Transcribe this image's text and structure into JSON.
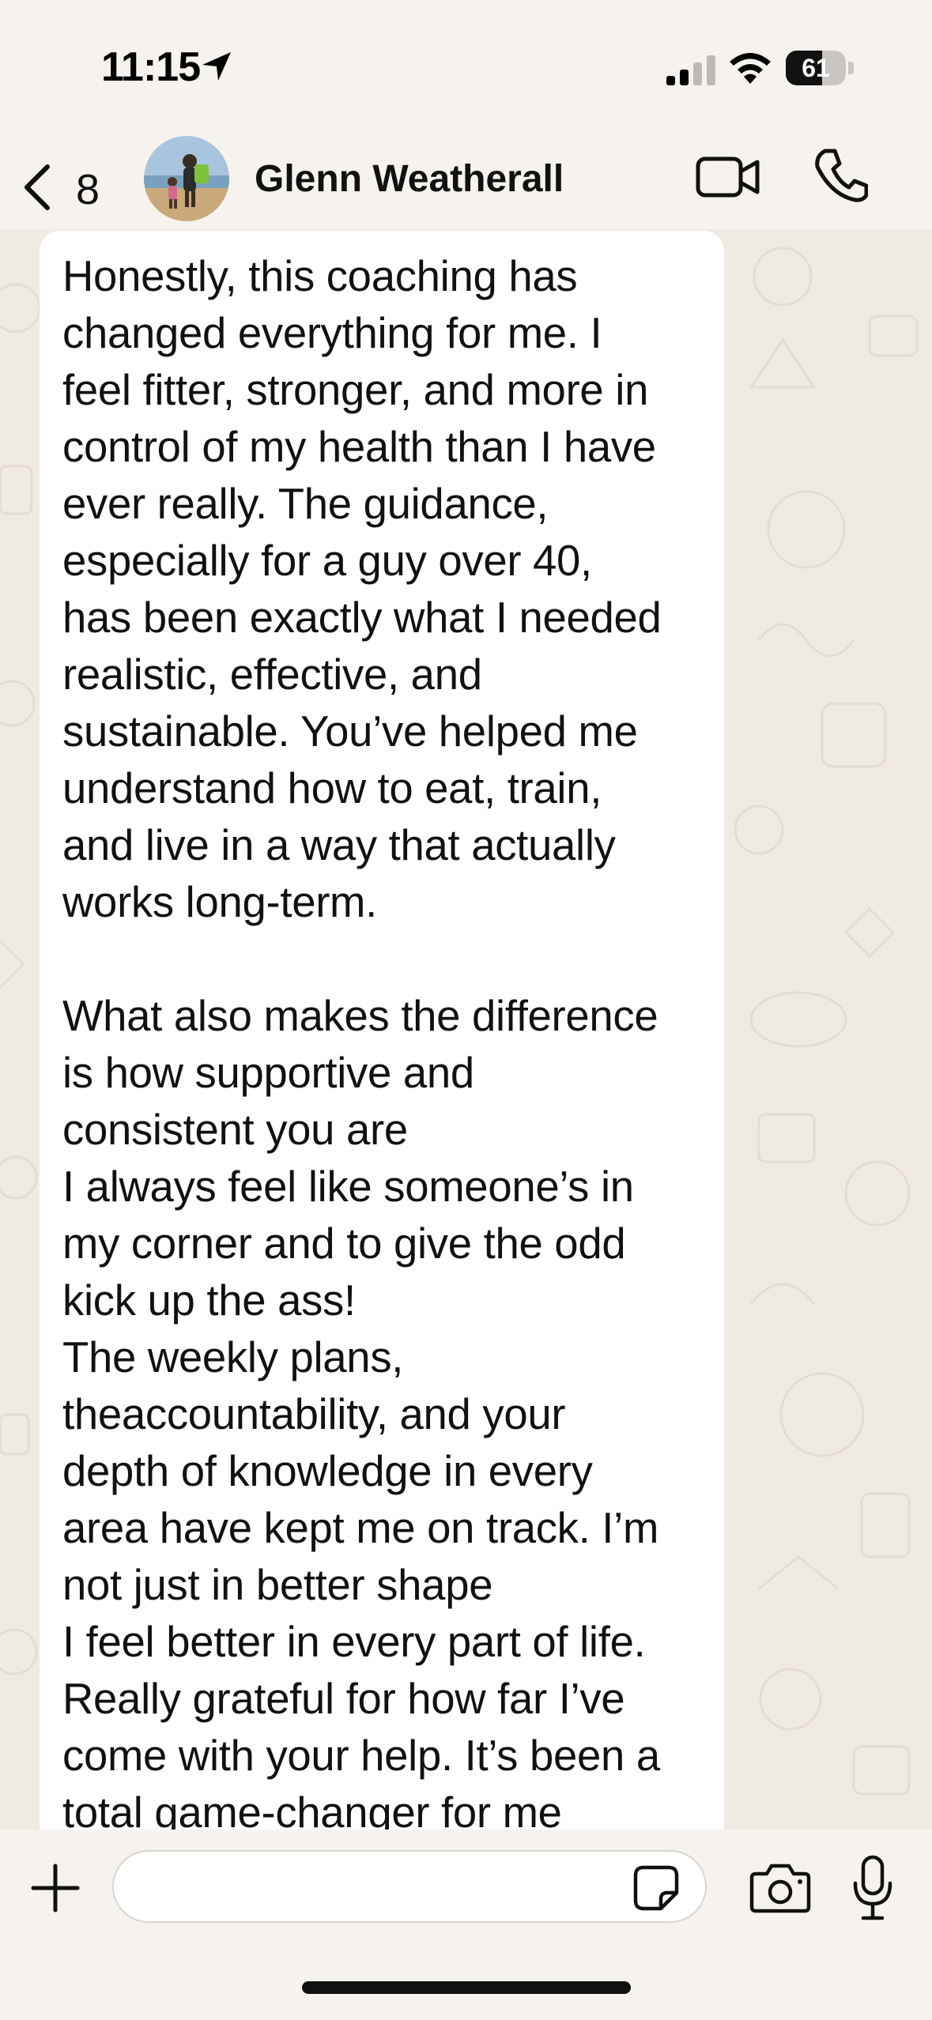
{
  "status_bar": {
    "time": "11:15",
    "battery_level": "61",
    "battery_fraction": 0.61,
    "signal_bars_active": 2,
    "signal_bars_total": 4,
    "icons": [
      "location-arrow-icon",
      "cellular-signal-icon",
      "wifi-icon",
      "battery-icon"
    ]
  },
  "header": {
    "unread_count": "8",
    "contact_name": "Glenn Weatherall",
    "icons": [
      "back-chevron-icon",
      "avatar",
      "video-call-icon",
      "phone-icon"
    ]
  },
  "message": {
    "text": "Honestly, this coaching has\nchanged everything for me. I\nfeel fitter, stronger, and more in\ncontrol of my health than I have\never really. The guidance,\nespecially for a guy over 40,\nhas been exactly what I needed\nrealistic, effective, and\nsustainable. You’ve helped me\nunderstand how to eat, train,\nand live in a way that actually\nworks long-term.\n\nWhat also makes the difference\nis how supportive and\nconsistent you are\nI always feel like someone’s in\nmy corner and to give the odd\nkick up the ass!\nThe weekly plans,\ntheaccountability, and your\ndepth of knowledge in every\narea have kept me on track. I’m\nnot just in better shape\nI feel better in every part of life.\nReally grateful for how far I’ve\ncome with your help. It’s been a\ntotal game-changer for me"
  },
  "input_bar": {
    "value": "",
    "placeholder": "",
    "icons": [
      "plus-icon",
      "sticker-icon",
      "camera-icon",
      "microphone-icon"
    ]
  },
  "colors": {
    "background": "#f6f3ee",
    "wallpaper": "#efeae2",
    "bubble": "#ffffff",
    "text": "#111111"
  }
}
